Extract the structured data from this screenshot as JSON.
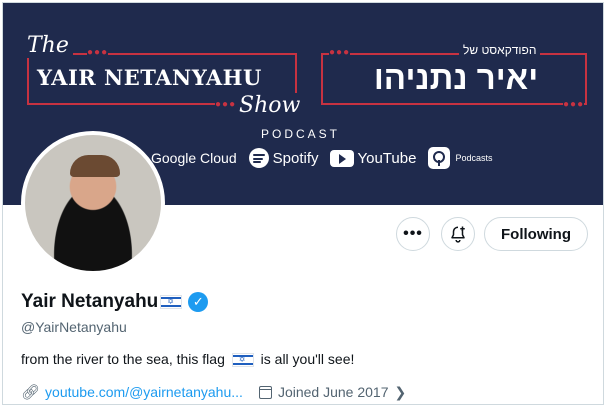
{
  "banner": {
    "the": "The",
    "show_name": "YAIR NETANYAHU",
    "show": "Show",
    "hebrew_small": "הפודקאסט של",
    "hebrew_big": "יאיר נתניהו",
    "podcast": "PODCAST",
    "partners": {
      "google_cloud": "Google Cloud",
      "spotify": "Spotify",
      "youtube": "YouTube",
      "apple": "Podcasts"
    }
  },
  "profile": {
    "name": "Yair Netanyahu",
    "handle": "@YairNetanyahu",
    "bio_before": "from the river to the sea, this flag",
    "bio_after": "is all you'll see!",
    "website": "youtube.com/@yairnetanyahu...",
    "joined": "Joined June 2017"
  },
  "actions": {
    "more": "•••",
    "following": "Following"
  },
  "icons": {
    "more": "more-icon",
    "notifications": "bell-plus-icon",
    "verified": "verified-badge-icon",
    "link": "link-icon",
    "calendar": "calendar-icon",
    "chevron": "chevron-right-icon",
    "flag": "israel-flag-icon"
  },
  "colors": {
    "banner_bg": "#1f2a4d",
    "banner_accent": "#c73241",
    "accent_blue": "#1d9bf0",
    "text_primary": "#0f1419",
    "text_secondary": "#536471"
  }
}
